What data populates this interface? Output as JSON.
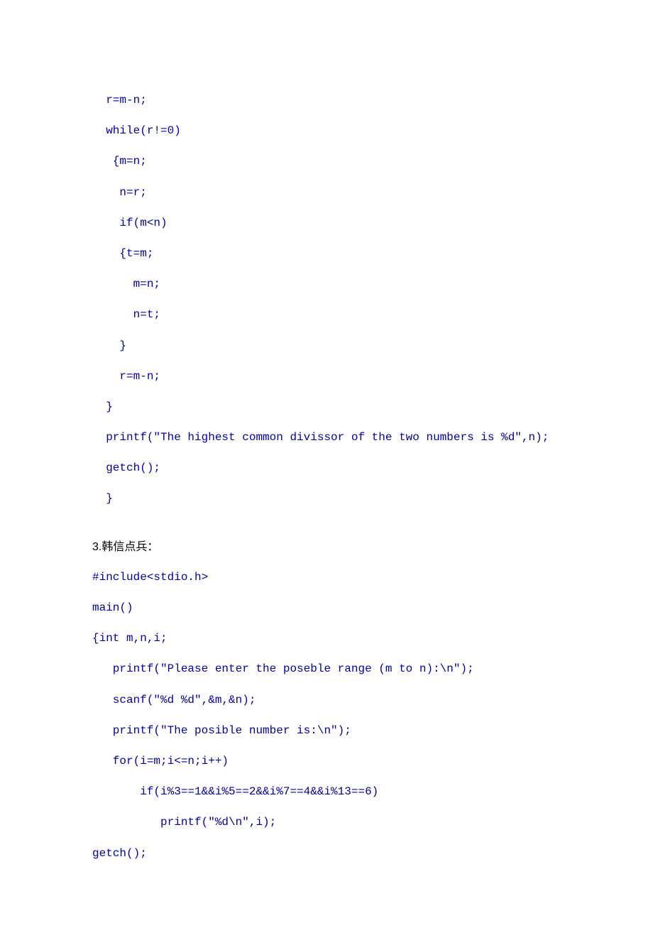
{
  "block1": {
    "lines": [
      "  r=m-n;",
      "  while(r!=0)",
      "   {m=n;",
      "    n=r;",
      "    if(m<n)",
      "    {t=m;",
      "      m=n;",
      "      n=t;",
      "    }",
      "    r=m-n;",
      "  }",
      "  printf(\"The highest common divissor of the two numbers is %d\",n);",
      "  getch();",
      "  }"
    ]
  },
  "heading": "3.韩信点兵：",
  "block2": {
    "lines": [
      "#include<stdio.h>",
      "main()",
      "{int m,n,i;",
      "   printf(\"Please enter the poseble range (m to n):\\n\");",
      "   scanf(\"%d %d\",&m,&n);",
      "   printf(\"The posible number is:\\n\");",
      "   for(i=m;i<=n;i++)",
      "       if(i%3==1&&i%5==2&&i%7==4&&i%13==6)",
      "          printf(\"%d\\n\",i);",
      "getch();"
    ]
  }
}
